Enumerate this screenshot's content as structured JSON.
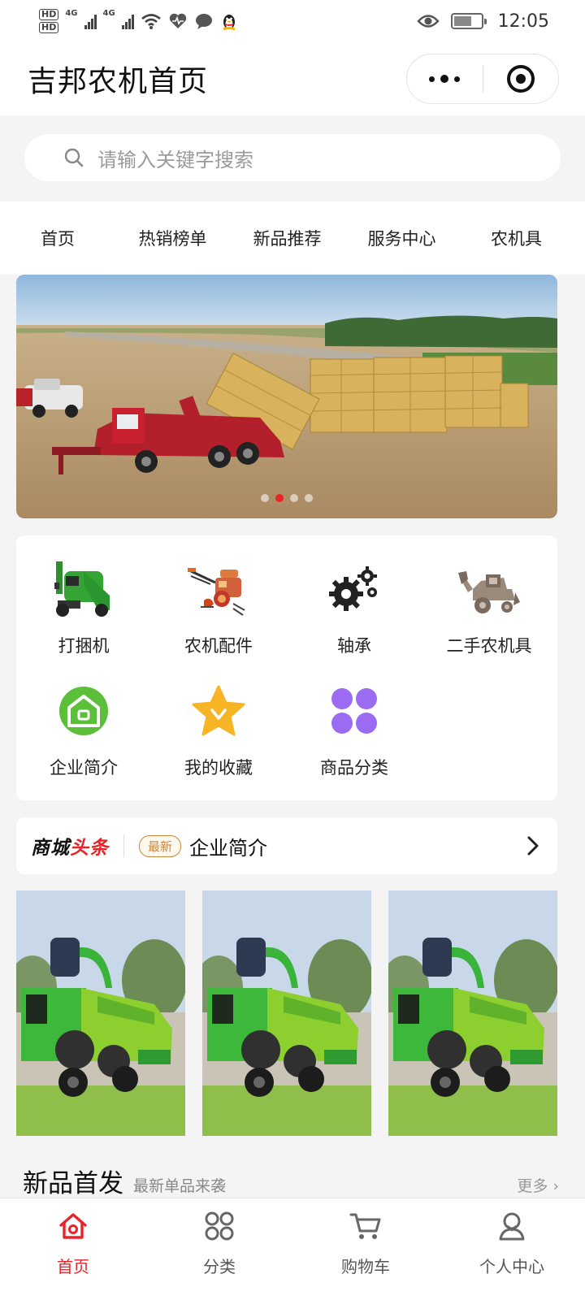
{
  "status_bar": {
    "hd1": "HD",
    "hd2": "HD",
    "net1": "4G",
    "net2": "4G",
    "time": "12:05"
  },
  "header": {
    "title": "吉邦农机首页"
  },
  "search": {
    "placeholder": "请输入关键字搜索"
  },
  "tabs": [
    "首页",
    "热销榜单",
    "新品推荐",
    "服务中心",
    "农机具"
  ],
  "banner": {
    "slide_count": 4,
    "active_index": 1
  },
  "categories": [
    {
      "label": "打捆机",
      "icon": "baler-machine-icon"
    },
    {
      "label": "农机配件",
      "icon": "tiller-parts-icon"
    },
    {
      "label": "轴承",
      "icon": "gears-icon"
    },
    {
      "label": "二手农机具",
      "icon": "backhoe-icon"
    },
    {
      "label": "企业简介",
      "icon": "house-icon"
    },
    {
      "label": "我的收藏",
      "icon": "star-icon"
    },
    {
      "label": "商品分类",
      "icon": "four-petal-icon"
    }
  ],
  "headline": {
    "logo_black": "商城",
    "logo_red": "头条",
    "badge": "最新",
    "text": "企业简介"
  },
  "new_products": {
    "title": "新品首发",
    "subtitle": "最新单品来袭",
    "more": "更多"
  },
  "bottom_nav": [
    {
      "label": "首页",
      "icon": "home-icon",
      "active": true
    },
    {
      "label": "分类",
      "icon": "category-grid-icon",
      "active": false
    },
    {
      "label": "购物车",
      "icon": "cart-icon",
      "active": false
    },
    {
      "label": "个人中心",
      "icon": "user-icon",
      "active": false
    }
  ],
  "colors": {
    "accent": "#e8232a",
    "badge": "#c9883b",
    "machine_green": "#3db83a"
  }
}
